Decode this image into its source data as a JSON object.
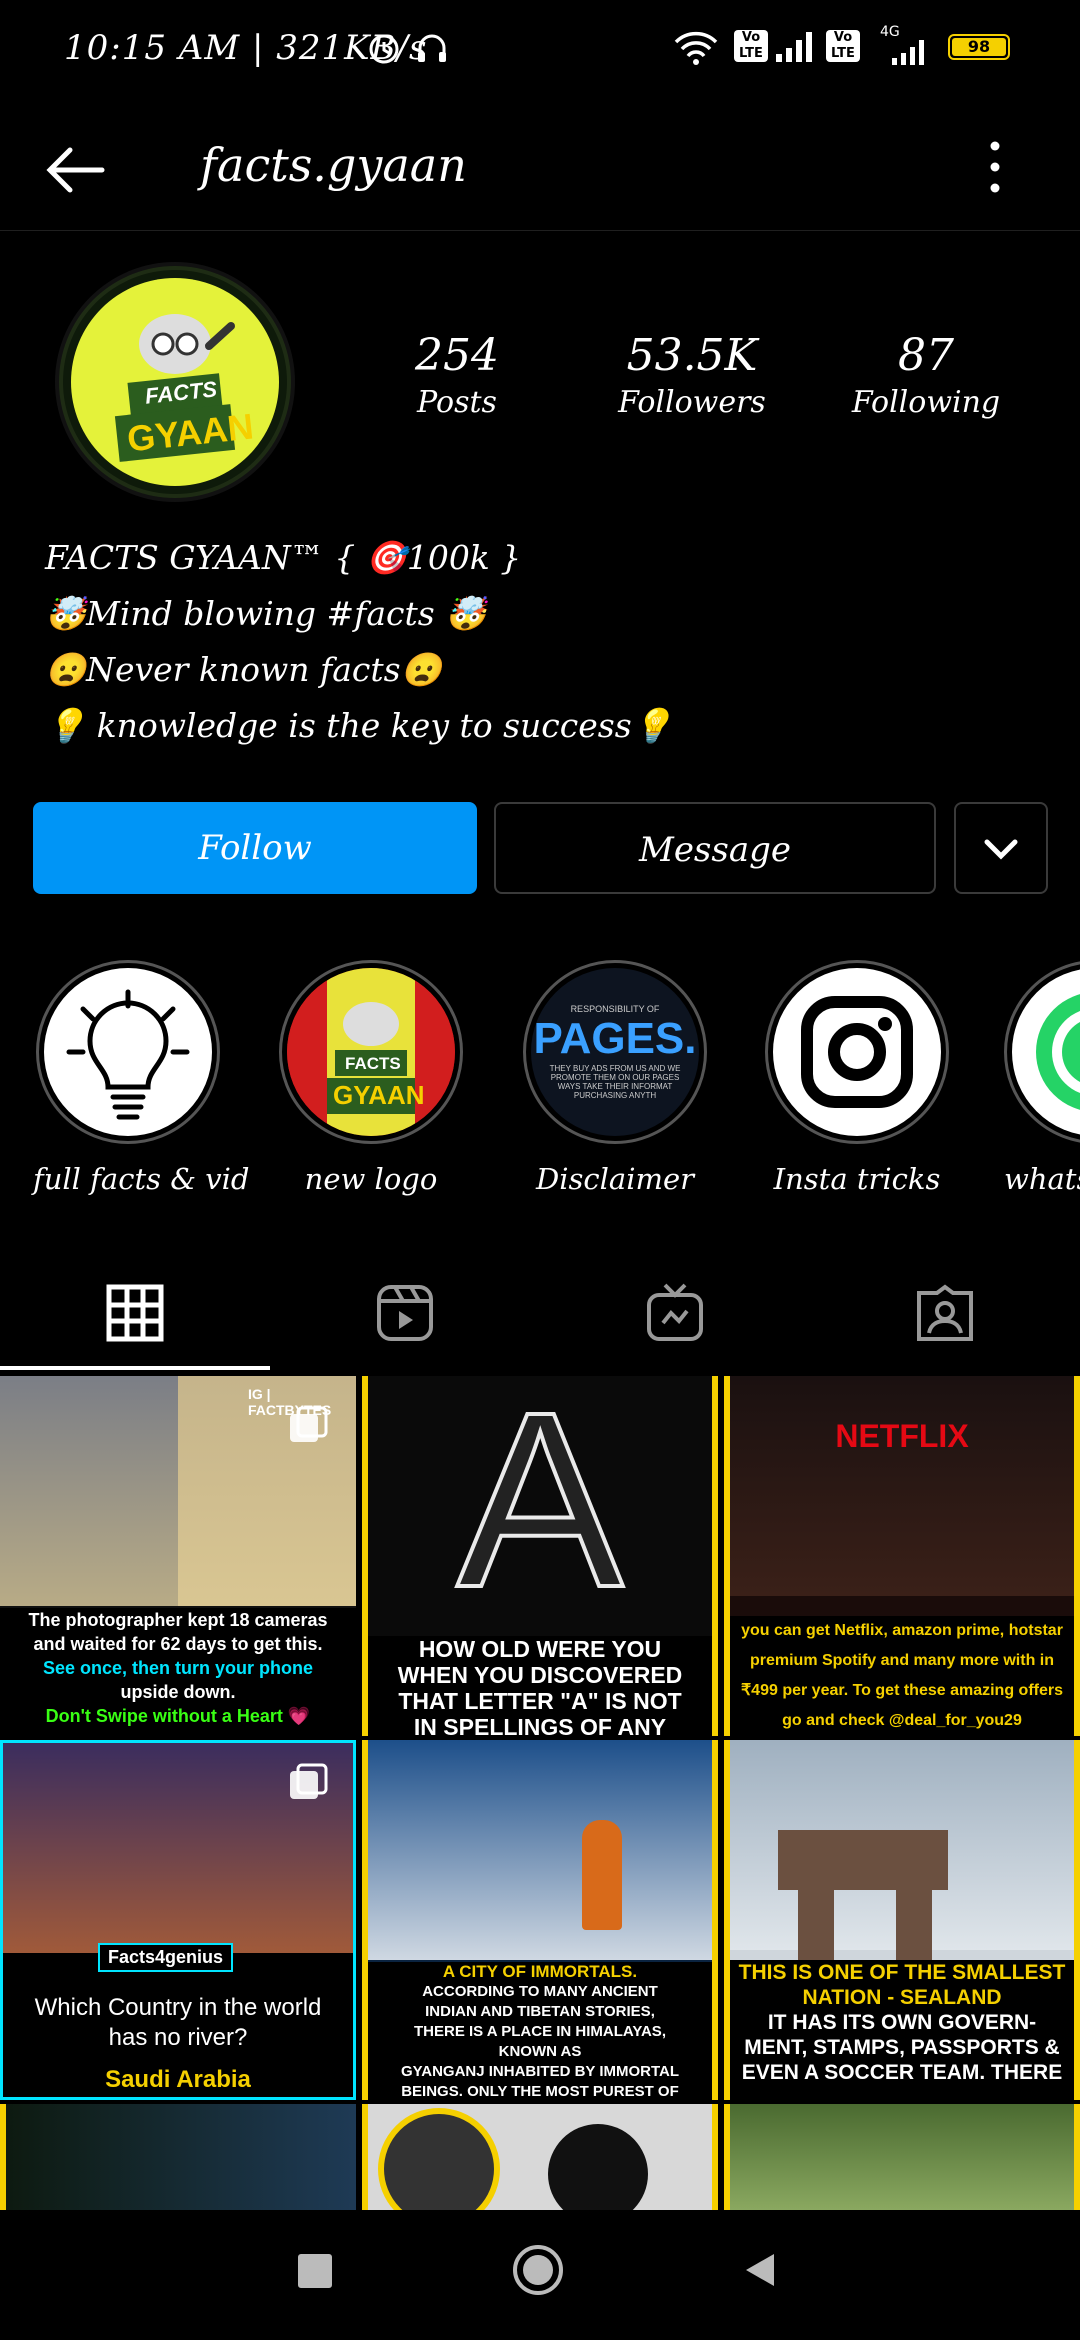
{
  "status_bar": {
    "time_speed": "10:15 AM | 321KB/s",
    "battery": "98",
    "network_4g": "4G",
    "volte1": "Vo LTE",
    "volte2": "Vo LTE"
  },
  "header": {
    "title": "facts.gyaan"
  },
  "profile": {
    "avatar_text_top": "FACTS",
    "avatar_text_bottom": "GYAAN",
    "stats": [
      {
        "value": "254",
        "label": "Posts"
      },
      {
        "value": "53.5K",
        "label": "Followers"
      },
      {
        "value": "87",
        "label": "Following"
      }
    ],
    "bio": [
      "FACTS GYAAN™ { 🎯100k }",
      "🤯Mind blowing #facts 🤯",
      "😦Never known facts😦",
      "💡 knowledge is the key to success💡"
    ]
  },
  "actions": {
    "follow": "Follow",
    "message": "Message"
  },
  "highlights": [
    {
      "label": "full facts & vid"
    },
    {
      "label": "new logo",
      "art_top": "FACTS",
      "art_bottom": "GYAAN"
    },
    {
      "label": "Disclaimer",
      "art_title": "PAGES.",
      "art_top": "RESPONSIBILITY OF",
      "art_lines": [
        "THEY BUY ADS FROM US AND WE",
        "PROMOTE THEM ON OUR PAGES",
        "WAYS TAKE THEIR INFORMAT",
        "PURCHASING ANYTH"
      ]
    },
    {
      "label": "Insta tricks"
    },
    {
      "label": "whatsA"
    }
  ],
  "grid": {
    "posts": [
      {
        "tag": "IG | FACTBYTES",
        "caption_lines": [
          "The photographer kept 18 cameras",
          "and waited for 62 days to get this.",
          "See once, then turn your phone",
          "upside down.",
          "Don't Swipe without a Heart 💗"
        ]
      },
      {
        "big_letter": "A",
        "caption_lines": [
          "HOW OLD WERE YOU",
          "WHEN YOU DISCOVERED",
          "THAT LETTER \"A\" IS NOT",
          "IN SPELLINGS OF ANY"
        ]
      },
      {
        "brand": "NETFLIX",
        "caption_lines": [
          "you can get Netflix, amazon prime, hotstar",
          "premium Spotify and many more with in",
          "₹499 per year. To get these amazing offers",
          "go and check @deal_for_you29"
        ]
      },
      {
        "tag": "Facts4genius",
        "caption_lines": [
          "Which Country in the world",
          "has no river?",
          "Saudi Arabia"
        ]
      },
      {
        "caption_lines": [
          "A CITY OF IMMORTALS.",
          "ACCORDING TO MANY ANCIENT",
          "INDIAN AND TIBETAN STORIES,",
          "THERE IS A PLACE IN HIMALAYAS,",
          "KNOWN AS",
          "GYANGANJ INHABITED BY IMMORTAL",
          "BEINGS. ONLY THE MOST PUREST OF"
        ]
      },
      {
        "caption_lines": [
          "THIS IS ONE OF THE SMALLEST",
          "NATION - SEALAND",
          "IT HAS ITS OWN GOVERN-",
          "MENT, STAMPS, PASSPORTS &",
          "EVEN A SOCCER TEAM. THERE"
        ]
      }
    ]
  },
  "colors": {
    "follow_blue": "#0095f6",
    "accent_yellow": "#f5d000",
    "green": "#39ff14",
    "pink": "#ff5fa2",
    "cyan": "#00e5ff"
  }
}
